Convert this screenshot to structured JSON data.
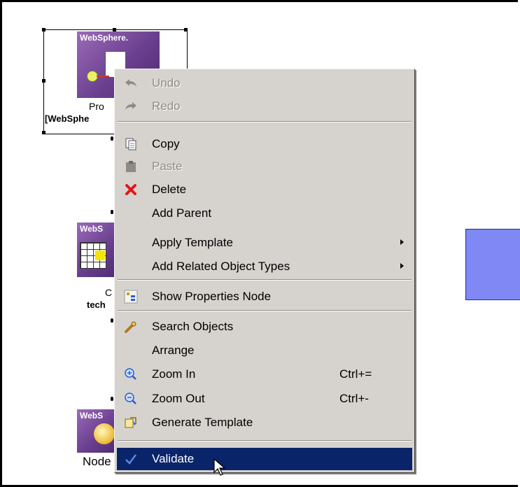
{
  "canvas": {
    "nodes": [
      {
        "brand": "WebSphere.",
        "label": "Pro",
        "sublabel": "[WebSphe"
      },
      {
        "brand": "WebS",
        "label": "C",
        "sublabel": "tech"
      },
      {
        "brand": "WebS",
        "label": "Node"
      }
    ]
  },
  "menu": {
    "items": [
      {
        "label": "Undo",
        "icon": "undo-icon",
        "disabled": true
      },
      {
        "label": "Redo",
        "icon": "redo-icon",
        "disabled": true
      },
      {
        "label": "Copy",
        "icon": "copy-icon"
      },
      {
        "label": "Paste",
        "icon": "paste-icon",
        "disabled": true
      },
      {
        "label": "Delete",
        "icon": "delete-icon"
      },
      {
        "label": "Add Parent"
      },
      {
        "label": "Apply Template",
        "submenu": true
      },
      {
        "label": "Add Related Object Types",
        "submenu": true
      },
      {
        "label": "Show Properties Node",
        "icon": "properties-icon"
      },
      {
        "label": "Search Objects",
        "icon": "search-icon"
      },
      {
        "label": "Arrange"
      },
      {
        "label": "Zoom In",
        "icon": "zoom-in-icon",
        "shortcut": "Ctrl+="
      },
      {
        "label": "Zoom Out",
        "icon": "zoom-out-icon",
        "shortcut": "Ctrl+-"
      },
      {
        "label": "Generate Template",
        "icon": "generate-template-icon"
      },
      {
        "label": "Validate",
        "icon": "validate-icon",
        "selected": true
      }
    ]
  },
  "colors": {
    "menu_bg": "#d6d3ce",
    "selection": "#0a246a",
    "node_accent": "#7f88f4"
  }
}
